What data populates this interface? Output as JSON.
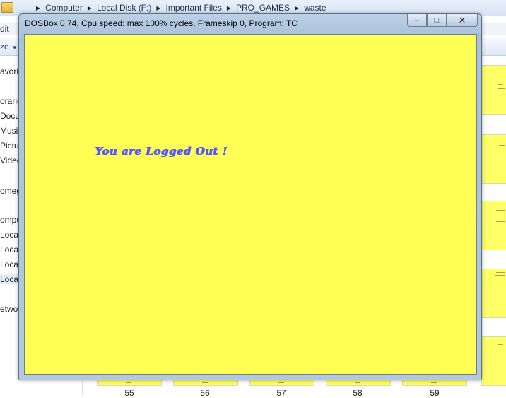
{
  "explorer": {
    "breadcrumbs": [
      "Computer",
      "Local Disk (F:)",
      "Important Files",
      "PRO_GAMES",
      "waste"
    ],
    "menu_edit": "dit",
    "organize_label": "ze",
    "nav_items": [
      "avorite",
      "orarie",
      "Docu",
      "Musi",
      "Pictu",
      "Video",
      "omeg",
      "ompu",
      "Local",
      "Local",
      "Local",
      "Local",
      "etwo"
    ],
    "thumb_labels": [
      "55",
      "56",
      "57",
      "58",
      "59"
    ]
  },
  "dosbox": {
    "title": "DOSBox 0.74, Cpu speed: max 100% cycles, Frameskip  0, Program:      TC",
    "minimize_glyph": "–",
    "maximize_glyph": "□",
    "close_glyph": "✕",
    "screen_color": "#ffff55",
    "text_color": "#5555ff",
    "message": "You are Logged Out !"
  }
}
